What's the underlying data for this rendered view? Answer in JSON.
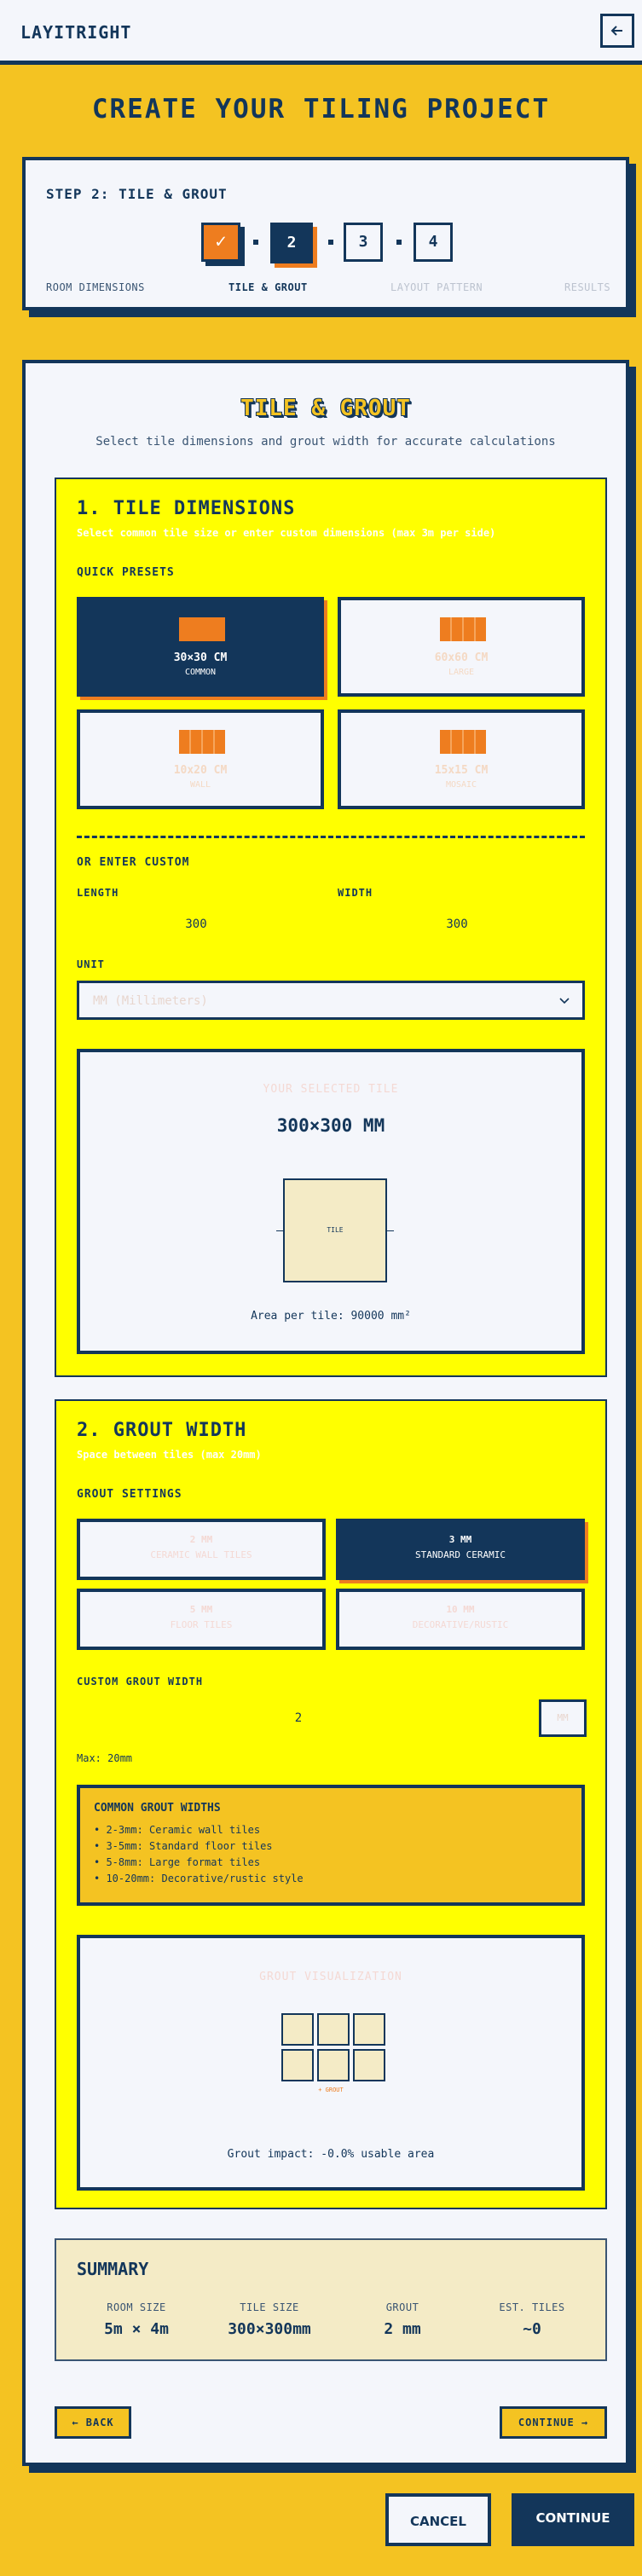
{
  "header": {
    "logo": "LAYITRIGHT",
    "back_icon": "arrow-left-icon"
  },
  "page": {
    "title": "CREATE YOUR TILING PROJECT"
  },
  "progress": {
    "heading": "STEP 2: TILE & GROUT",
    "steps": [
      {
        "label": "ROOM DIMENSIONS",
        "marker": "✓",
        "state": "done"
      },
      {
        "label": "TILE & GROUT",
        "marker": "2",
        "state": "active"
      },
      {
        "label": "LAYOUT PATTERN",
        "marker": "3",
        "state": "pending"
      },
      {
        "label": "RESULTS",
        "marker": "4",
        "state": "pending"
      }
    ]
  },
  "card": {
    "title": "TILE & GROUT",
    "subtitle": "Select tile dimensions and grout width for accurate calculations"
  },
  "tile_section": {
    "title": "1. TILE DIMENSIONS",
    "subtitle": "Select common tile size or enter custom dimensions (max 3m per side)",
    "presets_label": "QUICK PRESETS",
    "presets": [
      {
        "size": "30×30 CM",
        "tag": "COMMON",
        "selected": true
      },
      {
        "size": "60x60 CM",
        "tag": "LARGE",
        "selected": false
      },
      {
        "size": "10x20 CM",
        "tag": "WALL",
        "selected": false
      },
      {
        "size": "15x15 CM",
        "tag": "MOSAIC",
        "selected": false
      }
    ],
    "custom_label": "OR ENTER CUSTOM",
    "length_label": "LENGTH",
    "length_value": "300",
    "width_label": "WIDTH",
    "width_value": "300",
    "unit_label": "UNIT",
    "unit_value": "MM (Millimeters)",
    "preview": {
      "label": "YOUR SELECTED TILE",
      "size": "300×300 MM",
      "tile_text": "TILE",
      "area": "Area per tile: 90000 mm²"
    }
  },
  "grout_section": {
    "title": "2. GROUT WIDTH",
    "subtitle": "Space between tiles (max 20mm)",
    "settings_label": "GROUT SETTINGS",
    "options": [
      {
        "size": "2 MM",
        "tag": "CERAMIC WALL TILES",
        "selected": false
      },
      {
        "size": "3 MM",
        "tag": "STANDARD CERAMIC",
        "selected": true
      },
      {
        "size": "5 MM",
        "tag": "FLOOR TILES",
        "selected": false
      },
      {
        "size": "10 MM",
        "tag": "DECORATIVE/RUSTIC",
        "selected": false
      }
    ],
    "custom_label": "CUSTOM GROUT WIDTH",
    "custom_value": "2",
    "unit_button": "MM",
    "max_note": "Max: 20mm",
    "common": {
      "title": "COMMON GROUT WIDTHS",
      "items": [
        "2-3mm: Ceramic wall tiles",
        "3-5mm: Standard floor tiles",
        "5-8mm: Large format tiles",
        "10-20mm: Decorative/rustic style"
      ]
    },
    "visual": {
      "label": "GROUT VISUALIZATION",
      "marker": "+ GROUT",
      "impact": "Grout impact: -0.0% usable area"
    }
  },
  "summary": {
    "title": "SUMMARY",
    "items": [
      {
        "key": "ROOM SIZE",
        "value": "5m × 4m"
      },
      {
        "key": "TILE SIZE",
        "value": "300×300mm"
      },
      {
        "key": "GROUT",
        "value": "2 mm"
      },
      {
        "key": "EST. TILES",
        "value": "~0"
      }
    ]
  },
  "nav": {
    "back": "← BACK",
    "continue": "CONTINUE →"
  },
  "footer": {
    "cancel": "CANCEL",
    "continue": "CONTINUE"
  },
  "colors": {
    "navy": "#13365a",
    "yellow": "#f4c322",
    "bright_yellow": "#ffff00",
    "orange": "#ee7d1f",
    "paper": "#f4f6fb",
    "cream": "#f4ebc6"
  }
}
